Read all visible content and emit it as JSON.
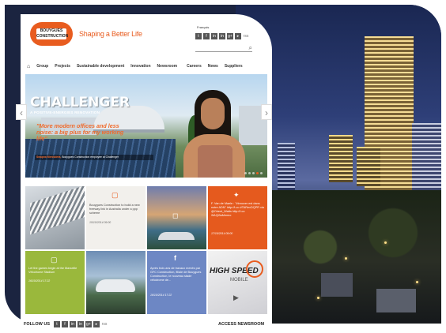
{
  "header": {
    "logo_text": "BOUYGUES CONSTRUCTION",
    "tagline": "Shaping a Better Life",
    "language": "Français",
    "social_top": [
      "t",
      "f",
      "in",
      "in",
      "g+",
      "▸",
      "rss"
    ]
  },
  "nav": {
    "items": [
      "Group",
      "Projects",
      "Sustainable development",
      "Innovation",
      "Newsroom"
    ],
    "right_items": [
      "Careers",
      "News",
      "Suppliers"
    ]
  },
  "hero": {
    "title": "CHALLENGER",
    "subtitle": "A POSITIVE-ENERGIES RENOVATION",
    "quote": "\"More modern offices and less noise: a big plus for my working life\"",
    "caption_name": "Swapna Menisdeta,",
    "caption_rest": " Bouygues Construction employee at Challenger"
  },
  "tiles": {
    "news1_text": "Bouygues Construction to build a new freeway link in Australia under a ppp scheme",
    "news1_date": "15/10/2014 09:00",
    "twitter1_text": "F. Van de Maele : \"#innover est dans notre ADN\" http://t.co #TARevDQPR via @Orient_Watts http://t.co /5AQi3aMmmo",
    "twitter1_date": "17/10/2014 09:00",
    "lime_text": "Let the games begin at the Marseille Vélodrome Stadium",
    "lime_date": "16/10/2014 17:22",
    "fb_text": "Après trois ans de travaux menés par GFC Construction, filiale de Bouygues Construction, le nouveau stade vélodrome de...",
    "fb_date": "16/10/2014 17:22",
    "speed_text": "HIGH SPEED",
    "speed_sub": "MOBILE"
  },
  "footer": {
    "follow_us": "FOLLOW US",
    "access": "ACCESS NEWSROOM",
    "social": [
      "t",
      "f",
      "in",
      "in",
      "g+",
      "▸",
      "rss"
    ]
  }
}
